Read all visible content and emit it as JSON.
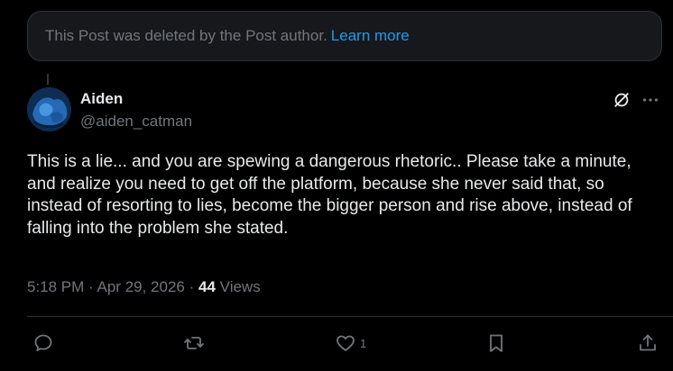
{
  "deleted_notice": {
    "text": "This Post was deleted by the Post author.",
    "link_label": "Learn more"
  },
  "author": {
    "name": "Aiden",
    "handle": "@aiden_catman"
  },
  "post": {
    "text": "This is a lie... and you are spewing a dangerous rhetoric.. Please take a minute, and realize you need to get off the platform, because she never said that, so instead of resorting to lies, become the bigger person and rise above, instead of falling into the problem she stated."
  },
  "meta": {
    "time": "5:18 PM",
    "date": "Apr 29, 2026",
    "separator": "·",
    "views_count": "44",
    "views_label": "Views"
  },
  "actions": {
    "like_count": "1"
  },
  "icons": {
    "top": [
      "grok-icon",
      "more-icon"
    ],
    "bar": [
      "reply-icon",
      "retweet-icon",
      "like-icon",
      "bookmark-icon",
      "share-icon"
    ]
  },
  "colors": {
    "background": "#000000",
    "banner": "#16181c",
    "border": "#2f3336",
    "text_primary": "#e7e9ea",
    "text_secondary": "#71767b",
    "link": "#1d9bf0"
  }
}
